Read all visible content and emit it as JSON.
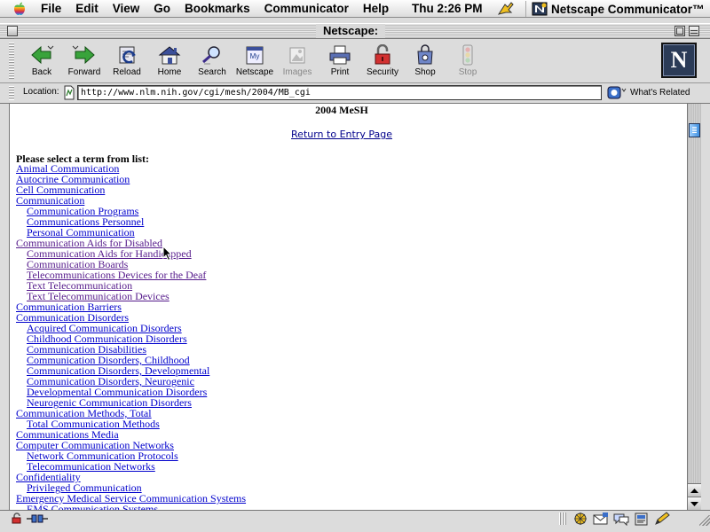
{
  "menubar": {
    "items": [
      "File",
      "Edit",
      "View",
      "Go",
      "Bookmarks",
      "Communicator",
      "Help"
    ],
    "clock": "Thu 2:26 PM",
    "app_name": "Netscape Communicator™",
    "apple_icon": "apple-icon"
  },
  "window": {
    "title": "Netscape:"
  },
  "toolbar": {
    "back": "Back",
    "forward": "Forward",
    "reload": "Reload",
    "home": "Home",
    "search": "Search",
    "netscape": "Netscape",
    "images": "Images",
    "print": "Print",
    "security": "Security",
    "shop": "Shop",
    "stop": "Stop",
    "logo_letter": "N"
  },
  "location": {
    "label": "Location:",
    "url": "http://www.nlm.nih.gov/cgi/mesh/2004/MB_cgi",
    "whats_related": "What's Related"
  },
  "page": {
    "title": "2004 MeSH",
    "return_link": "Return to Entry Page",
    "prompt": "Please select a term from list:",
    "terms": [
      {
        "label": "Animal Communication",
        "level": 0,
        "visited": false
      },
      {
        "label": "Autocrine Communication",
        "level": 0,
        "visited": false
      },
      {
        "label": "Cell Communication",
        "level": 0,
        "visited": false
      },
      {
        "label": "Communication",
        "level": 0,
        "visited": false
      },
      {
        "label": "Communication Programs",
        "level": 1,
        "visited": false
      },
      {
        "label": "Communications Personnel",
        "level": 1,
        "visited": false
      },
      {
        "label": "Personal Communication",
        "level": 1,
        "visited": false
      },
      {
        "label": "Communication Aids for Disabled",
        "level": 0,
        "visited": true
      },
      {
        "label": "Communication Aids for Handicapped",
        "level": 1,
        "visited": true
      },
      {
        "label": "Communication Boards",
        "level": 1,
        "visited": true
      },
      {
        "label": "Telecommunications Devices for the Deaf",
        "level": 1,
        "visited": true
      },
      {
        "label": "Text Telecommunication",
        "level": 1,
        "visited": true
      },
      {
        "label": "Text Telecommunication Devices",
        "level": 1,
        "visited": true
      },
      {
        "label": "Communication Barriers",
        "level": 0,
        "visited": false
      },
      {
        "label": "Communication Disorders",
        "level": 0,
        "visited": false
      },
      {
        "label": "Acquired Communication Disorders",
        "level": 1,
        "visited": false
      },
      {
        "label": "Childhood Communication Disorders",
        "level": 1,
        "visited": false
      },
      {
        "label": "Communication Disabilities",
        "level": 1,
        "visited": false
      },
      {
        "label": "Communication Disorders, Childhood",
        "level": 1,
        "visited": false
      },
      {
        "label": "Communication Disorders, Developmental",
        "level": 1,
        "visited": false
      },
      {
        "label": "Communication Disorders, Neurogenic",
        "level": 1,
        "visited": false
      },
      {
        "label": "Developmental Communication Disorders",
        "level": 1,
        "visited": false
      },
      {
        "label": "Neurogenic Communication Disorders",
        "level": 1,
        "visited": false
      },
      {
        "label": "Communication Methods, Total",
        "level": 0,
        "visited": false
      },
      {
        "label": "Total Communication Methods",
        "level": 1,
        "visited": false
      },
      {
        "label": "Communications Media",
        "level": 0,
        "visited": false
      },
      {
        "label": "Computer Communication Networks",
        "level": 0,
        "visited": false
      },
      {
        "label": "Network Communication Protocols",
        "level": 1,
        "visited": false
      },
      {
        "label": "Telecommunication Networks",
        "level": 1,
        "visited": false
      },
      {
        "label": "Confidentiality",
        "level": 0,
        "visited": false
      },
      {
        "label": "Privileged Communication",
        "level": 1,
        "visited": false
      },
      {
        "label": "Emergency Medical Service Communication Systems",
        "level": 0,
        "visited": false
      },
      {
        "label": "EMS Communication Systems",
        "level": 1,
        "visited": false
      }
    ]
  },
  "status": {
    "text": ""
  },
  "colors": {
    "link": "#0000cc",
    "visited_link": "#551a8b",
    "chrome": "#dcdcdc",
    "scroll_thumb": "#3f8fe0"
  }
}
